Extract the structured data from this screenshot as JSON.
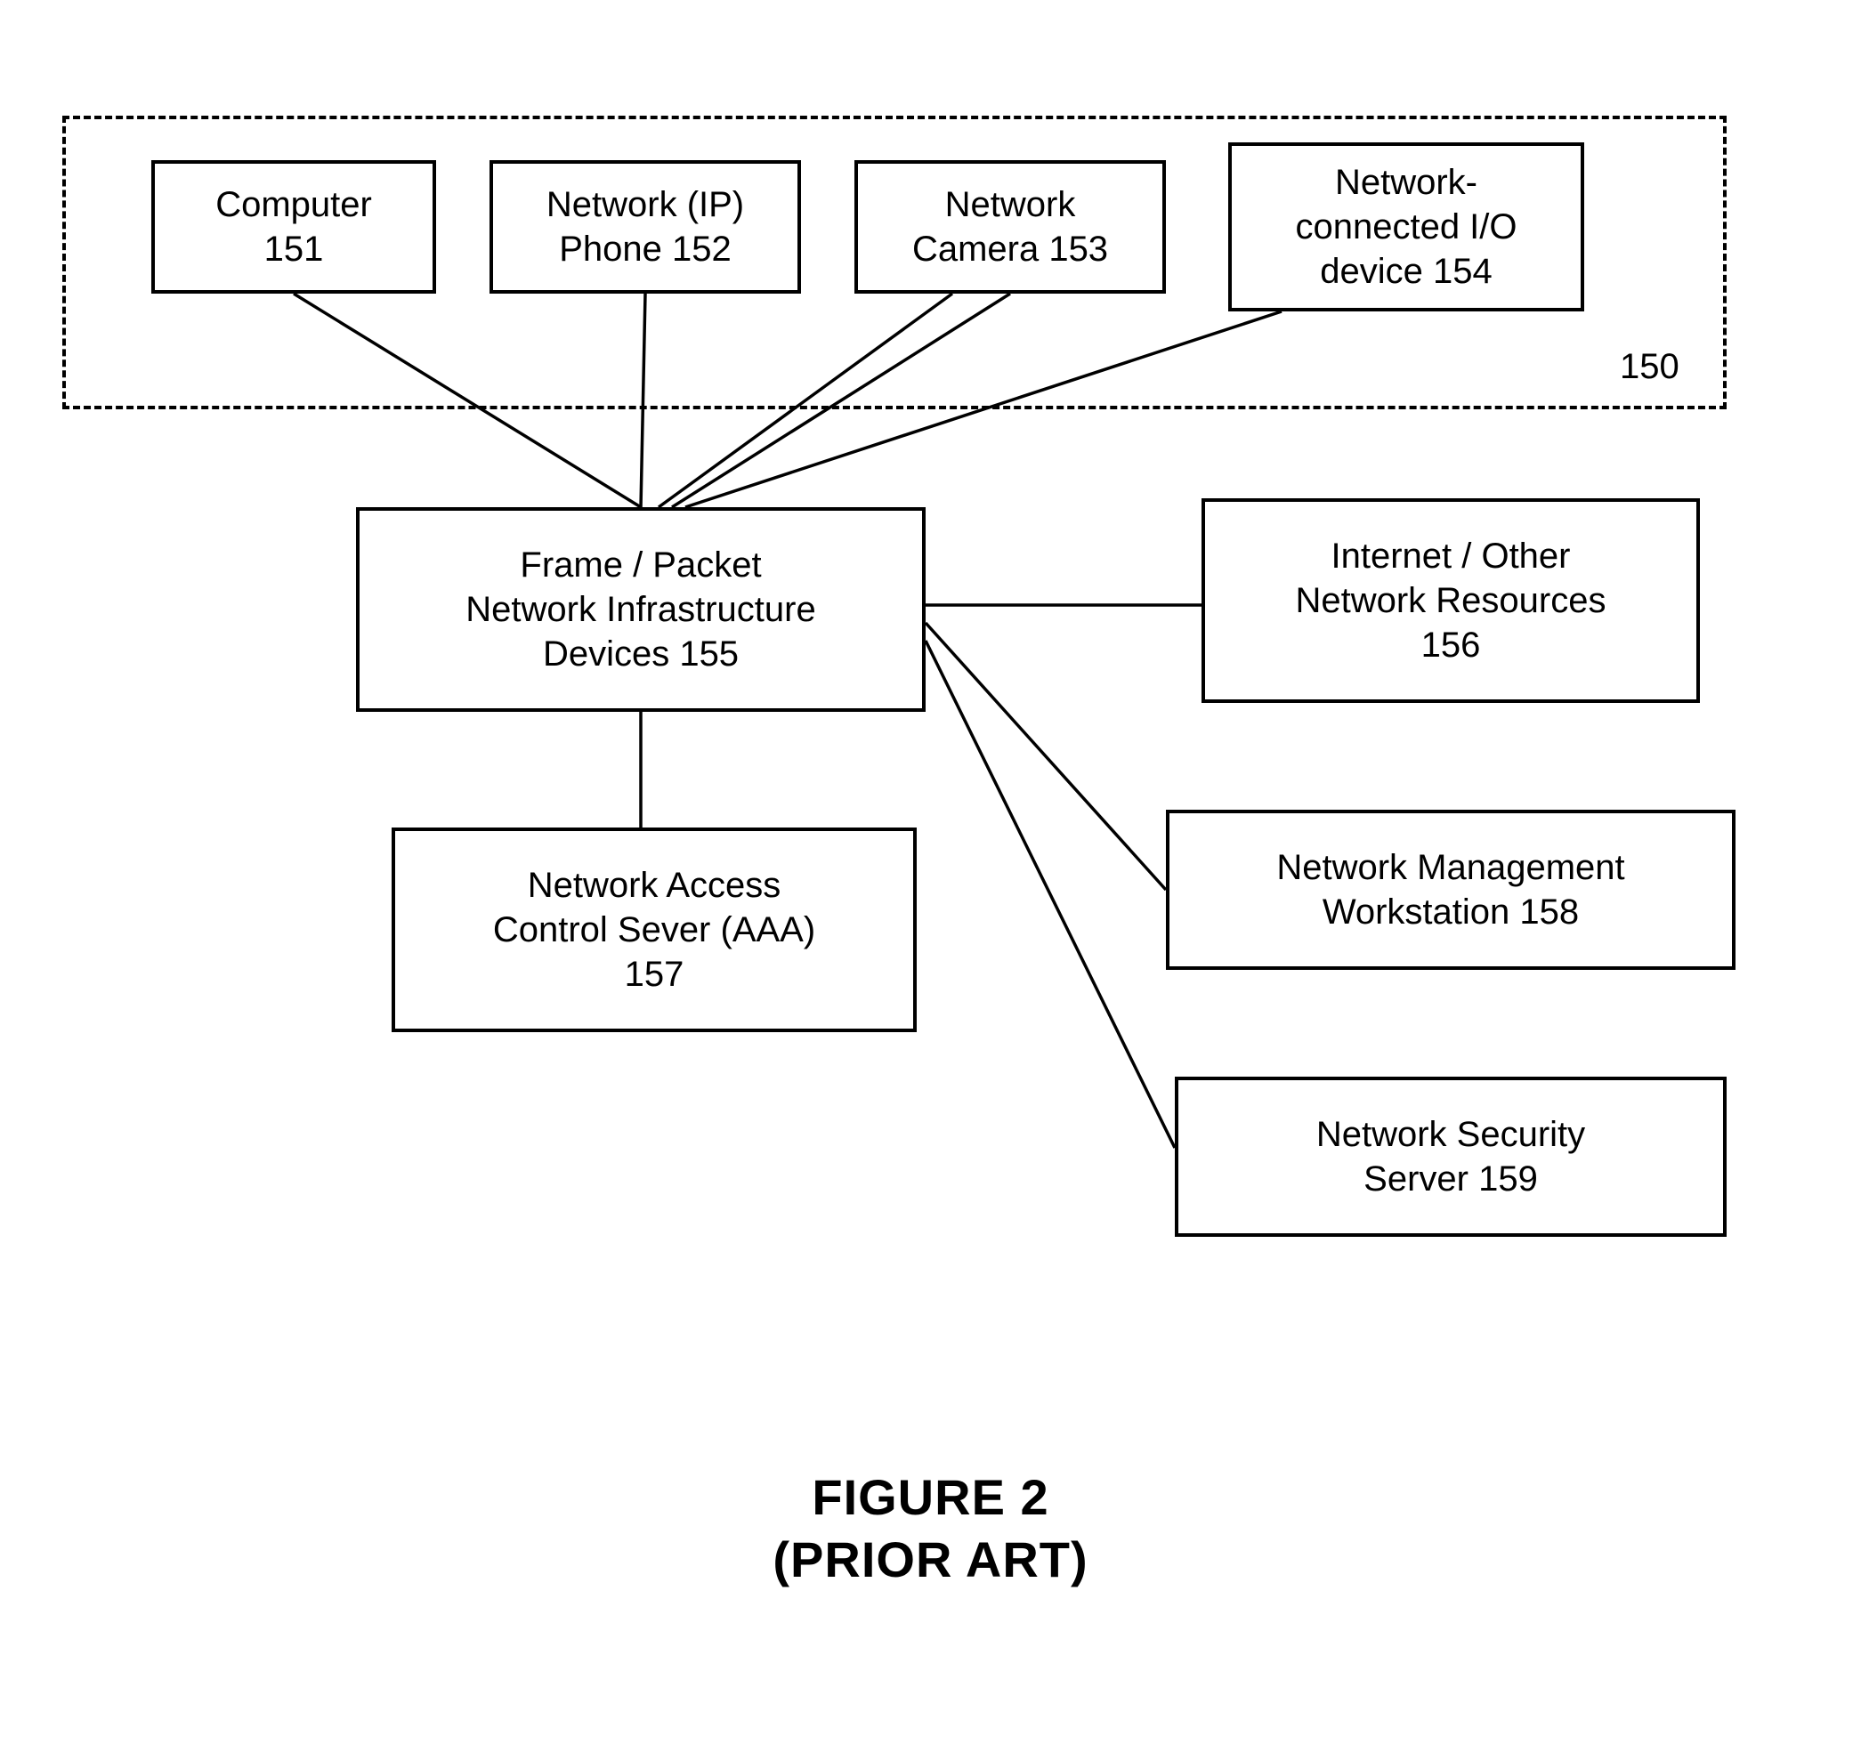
{
  "group": {
    "ref": "150"
  },
  "boxes": {
    "computer": {
      "line1": "Computer",
      "line2": "151"
    },
    "ipphone": {
      "line1": "Network (IP)",
      "line2": "Phone 152"
    },
    "camera": {
      "line1": "Network",
      "line2": "Camera 153"
    },
    "iodevice": {
      "line1": "Network-",
      "line2": "connected I/O",
      "line3": "device 154"
    },
    "infra": {
      "line1": "Frame / Packet",
      "line2": "Network Infrastructure",
      "line3": "Devices 155"
    },
    "internet": {
      "line1": "Internet / Other",
      "line2": "Network Resources",
      "line3": "156"
    },
    "aaa": {
      "line1": "Network Access",
      "line2": "Control Sever (AAA)",
      "line3": "157"
    },
    "mgmt": {
      "line1": "Network Management",
      "line2": "Workstation 158"
    },
    "security": {
      "line1": "Network Security",
      "line2": "Server 159"
    }
  },
  "figure": {
    "line1": "FIGURE 2",
    "line2": "(PRIOR ART)"
  }
}
